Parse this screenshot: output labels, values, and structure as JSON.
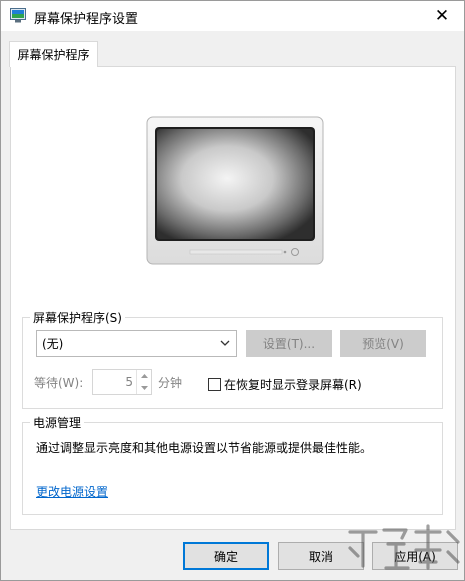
{
  "window": {
    "title": "屏幕保护程序设置",
    "close_glyph": "✕"
  },
  "tab": {
    "label": "屏幕保护程序"
  },
  "screensaver": {
    "group_label": "屏幕保护程序(S)",
    "selected": "(无)",
    "settings_label": "设置(T)...",
    "preview_label": "预览(V)",
    "wait_label": "等待(W):",
    "wait_value": "5",
    "minutes_label": "分钟",
    "resume_label": "在恢复时显示登录屏幕(R)",
    "resume_checked": false
  },
  "power": {
    "group_label": "电源管理",
    "description": "通过调整显示亮度和其他电源设置以节省能源或提供最佳性能。",
    "link_label": "更改电源设置"
  },
  "footer": {
    "ok_label": "确定",
    "cancel_label": "取消",
    "apply_label": "应用(A)"
  },
  "icons": {
    "title": "screensaver-monitor-icon",
    "close": "close-icon",
    "dropdown": "chevron-down-icon",
    "spin_up": "spin-up-icon",
    "spin_down": "spin-down-icon"
  },
  "colors": {
    "accent": "#0078d7",
    "link": "#0066cc",
    "disabled_bg": "#cccccc",
    "disabled_text": "#838383"
  }
}
